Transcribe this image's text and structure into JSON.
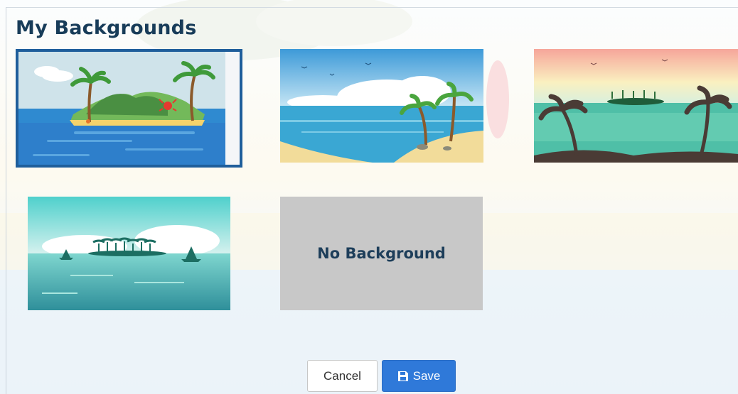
{
  "page": {
    "title": "My Backgrounds"
  },
  "backgrounds": [
    {
      "name": "Island with palm trees and crab",
      "selected": true
    },
    {
      "name": "Beach with palm trees",
      "selected": false
    },
    {
      "name": "Sunset islands silhouette",
      "selected": false
    },
    {
      "name": "Teal sea with sailboats",
      "selected": false
    }
  ],
  "no_background": {
    "label": "No Background"
  },
  "buttons": {
    "cancel": "Cancel",
    "save": "Save"
  },
  "colors": {
    "title": "#183c59",
    "selected_border": "#1f5e9b",
    "save_button": "#2f79d9"
  },
  "icons": {
    "save": "floppy-disk-icon"
  }
}
